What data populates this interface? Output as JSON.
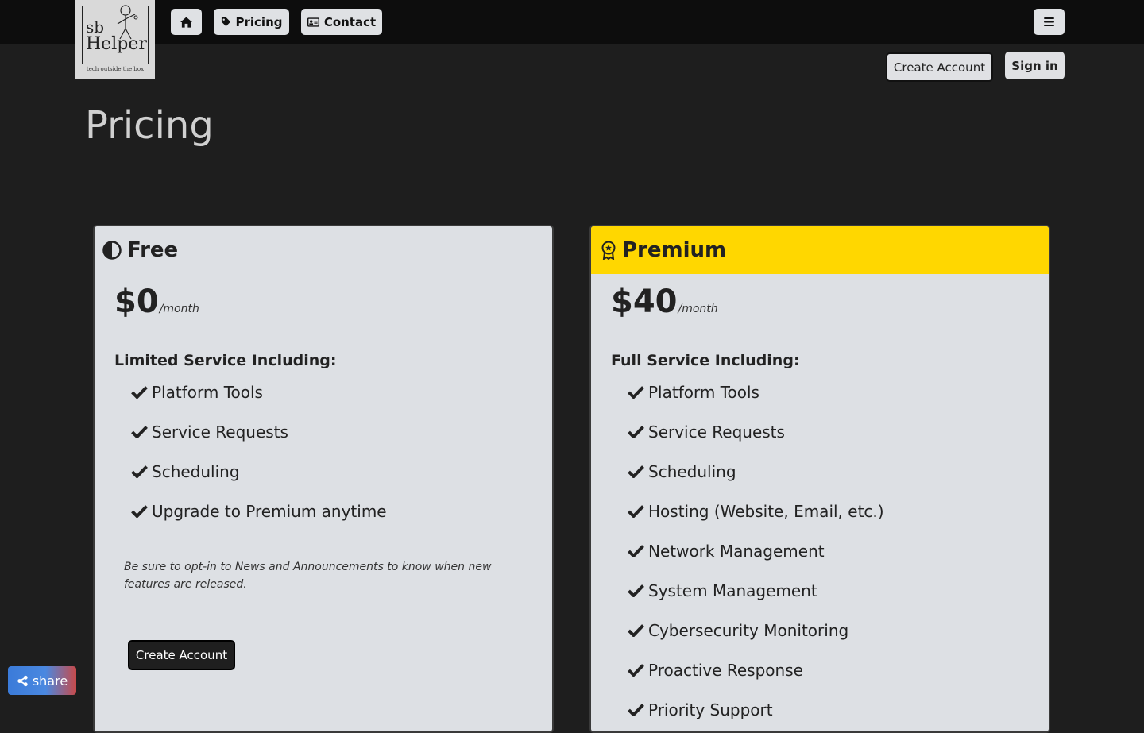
{
  "logo": {
    "line1": "sb",
    "line2": "Helper",
    "tagline": "tech outside the box"
  },
  "nav": {
    "home_icon": "home-icon",
    "pricing_label": "Pricing",
    "pricing_icon": "tag-icon",
    "contact_label": "Contact",
    "contact_icon": "contact-card-icon",
    "menu_icon": "hamburger-menu-icon"
  },
  "auth": {
    "create_account_label": "Create Account",
    "sign_in_label": "Sign in"
  },
  "page": {
    "title": "Pricing"
  },
  "plans": [
    {
      "name": "Free",
      "icon": "half-circle-icon",
      "price": "$0",
      "unit": "/month",
      "included_heading": "Limited Service Including:",
      "features": [
        "Platform Tools",
        "Service Requests",
        "Scheduling",
        "Upgrade to Premium anytime"
      ],
      "note": "Be sure to opt-in to News and Announcements to know when new features are released.",
      "button_label": "Create Account"
    },
    {
      "name": "Premium",
      "icon": "award-ribbon-icon",
      "header_color": "#ffd700",
      "price": "$40",
      "unit": "/month",
      "included_heading": "Full Service Including:",
      "features": [
        "Platform Tools",
        "Service Requests",
        "Scheduling",
        "Hosting (Website, Email, etc.)",
        "Network Management",
        "System Management",
        "Cybersecurity Monitoring",
        "Proactive Response",
        "Priority Support"
      ]
    }
  ],
  "share": {
    "label": "share",
    "icon": "share-icon"
  },
  "colors": {
    "background": "#1e1e1e",
    "topbar": "#0d0d0d",
    "premium_accent": "#ffd700",
    "card": "#dde0e4"
  }
}
